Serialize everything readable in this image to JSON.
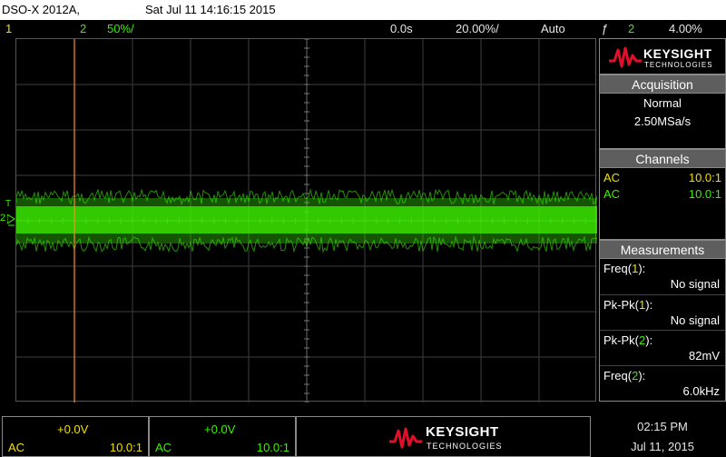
{
  "title_bar": {
    "model": "DSO-X 2012A,",
    "datetime": "Sat Jul 11 14:16:15 2015"
  },
  "status_bar": {
    "ch1_num": "1",
    "ch2_num": "2",
    "ch2_scale": "50%/",
    "time_delay": "0.0s",
    "time_scale": "20.00%/",
    "trigger_mode": "Auto",
    "trigger_symbol": "ƒ",
    "trigger_source": "2",
    "trigger_level": "4.00%"
  },
  "markers": {
    "trigger_marker": "T",
    "ch2_marker": "2"
  },
  "right_panel": {
    "logo": {
      "word": "KEYSIGHT",
      "sub": "TECHNOLOGIES"
    },
    "acquisition": {
      "header": "Acquisition",
      "mode": "Normal",
      "rate": "2.50MSa/s"
    },
    "channels": {
      "header": "Channels",
      "rows": [
        {
          "coupling": "AC",
          "probe": "10.0:1",
          "color": "#f0e000"
        },
        {
          "coupling": "AC",
          "probe": "10.0:1",
          "color": "#3cf000"
        }
      ]
    },
    "measurements": {
      "header": "Measurements",
      "items": [
        {
          "name": "Freq",
          "ch": "1",
          "value": "No signal",
          "color": "#f0e000"
        },
        {
          "name": "Pk-Pk",
          "ch": "1",
          "value": "No signal",
          "color": "#f0e000"
        },
        {
          "name": "Pk-Pk",
          "ch": "2",
          "value": "82mV",
          "color": "#3cf000"
        },
        {
          "name": "Freq",
          "ch": "2",
          "value": "6.0kHz",
          "color": "#3cf000"
        }
      ]
    }
  },
  "bottom": {
    "ch1": {
      "offset": "+0.0V",
      "coupling": "AC",
      "probe": "10.0:1"
    },
    "ch2": {
      "offset": "+0.0V",
      "coupling": "AC",
      "probe": "10.0:1"
    },
    "logo": {
      "word": "KEYSIGHT",
      "sub": "TECHNOLOGIES"
    },
    "time": "02:15 PM",
    "date": "Jul 11, 2015"
  },
  "colors": {
    "ch1": "#f0e000",
    "ch2": "#3cf000",
    "trigger_cursor": "#ff9020",
    "logo_red": "#e0102a"
  }
}
